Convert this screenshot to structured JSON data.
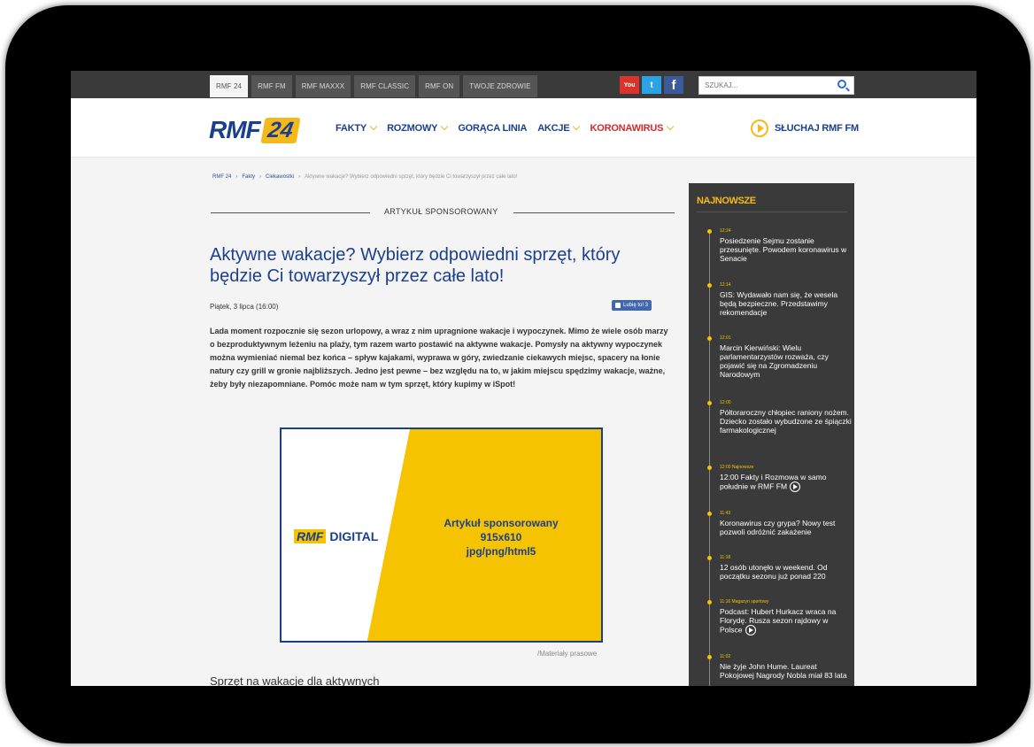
{
  "topbar": {
    "tabs": [
      {
        "label": "RMF 24",
        "active": true
      },
      {
        "label": "RMF FM",
        "active": false
      },
      {
        "label": "RMF MAXXX",
        "active": false
      },
      {
        "label": "RMF CLASSIC",
        "active": false
      },
      {
        "label": "RMF ON",
        "active": false
      },
      {
        "label": "TWOJE ZDROWIE",
        "active": false
      }
    ],
    "socials": {
      "youtube": "You",
      "twitter": "t",
      "facebook": "f"
    },
    "search_placeholder": "SZUKAJ..."
  },
  "header": {
    "logo_rmf": "RMF",
    "logo_24": "24",
    "nav": [
      "FAKTY",
      "ROZMOWY",
      "GORĄCA LINIA",
      "AKCJE",
      "KORONAWIRUS"
    ],
    "listen_label": "SŁUCHAJ RMF FM"
  },
  "breadcrumb": [
    "RMF 24",
    "Fakty",
    "Ciekawostki",
    "Aktywne wakacje? Wybierz odpowiedni sprzęt, który będzie Ci towarzyszył przez całe lato!"
  ],
  "article": {
    "sponsor_label": "ARTYKUŁ SPONSOROWANY",
    "title": "Aktywne wakacje? Wybierz odpowiedni sprzęt, który będzie Ci towarzyszył przez całe lato!",
    "date": "Piątek, 3 lipca (16:00)",
    "like_label": "Lubię to! 3",
    "lead": "Lada moment rozpocznie się sezon urlopowy, a wraz z nim upragnione wakacje i wypoczynek. Mimo że wiele osób marzy o bezproduktywnym leżeniu na plaży, tym razem warto postawić na aktywne wakacje. Pomysły na aktywny wypoczynek można wymieniać niemal bez końca – spływ kajakami, wyprawa w góry, zwiedzanie ciekawych miejsc, spacery na łonie natury czy grill w gronie najbliższych. Jedno jest pewne – bez względu na to, w jakim miejscu spędzimy wakacje, ważne, żeby były niezapomniane. Pomóc może nam w tym sprzęt, który kupimy w iSpot!",
    "banner": {
      "logo_rmf": "RMF",
      "logo_digital": "DIGITAL",
      "line1": "Artykuł sponsorowany",
      "line2": "915x610",
      "line3": "jpg/png/html5"
    },
    "caption": "/Materiały prasowe",
    "subheading": "Sprzęt na wakacje dla aktywnych"
  },
  "sidebar": {
    "title": "NAJNOWSZE",
    "items": [
      {
        "time": "12:24",
        "title": "Posiedzenie Sejmu zostanie przesunięte. Powodem koronawirus w Senacie",
        "play": false
      },
      {
        "time": "12:14",
        "title": "GIS: Wydawało nam się, że wesela będą bezpieczne. Przedstawimy rekomendacje",
        "play": false
      },
      {
        "time": "12:01",
        "title": "Marcin Kierwiński: Wielu parlamentarzystów rozważa, czy pojawić się na Zgromadzeniu Narodowym",
        "play": false
      },
      {
        "time": "12:00",
        "title": "Półtoraroczny chłopiec raniony nożem. Dziecko zostało wybudzone ze śpiączki farmakologicznej",
        "play": false
      },
      {
        "time": "12:00 Najnowsze",
        "title": "12:00 Fakty i Rozmowa w samo południe w RMF FM",
        "play": true
      },
      {
        "time": "11:43",
        "title": "Koronawirus czy grypa? Nowy test pozwoli odróżnić zakażenie",
        "play": false
      },
      {
        "time": "11:18",
        "title": "12 osób utonęło w weekend. Od początku sezonu już ponad 220",
        "play": false
      },
      {
        "time": "11:16 Magazyn sportowy",
        "title": "Podcast: Hubert Hurkacz wraca na Florydę. Rusza sezon rajdowy w Polsce",
        "play": true
      },
      {
        "time": "11:02",
        "title": "Nie żyje John Hume. Laureat Pokojowej Nagrody Nobla miał 83 lata",
        "play": false
      }
    ]
  },
  "colors": {
    "brand_blue": "#1b3f8f",
    "brand_yellow": "#f6b91c",
    "alert_red": "#d72a2a",
    "sidebar_bg": "#3a3a3a"
  }
}
